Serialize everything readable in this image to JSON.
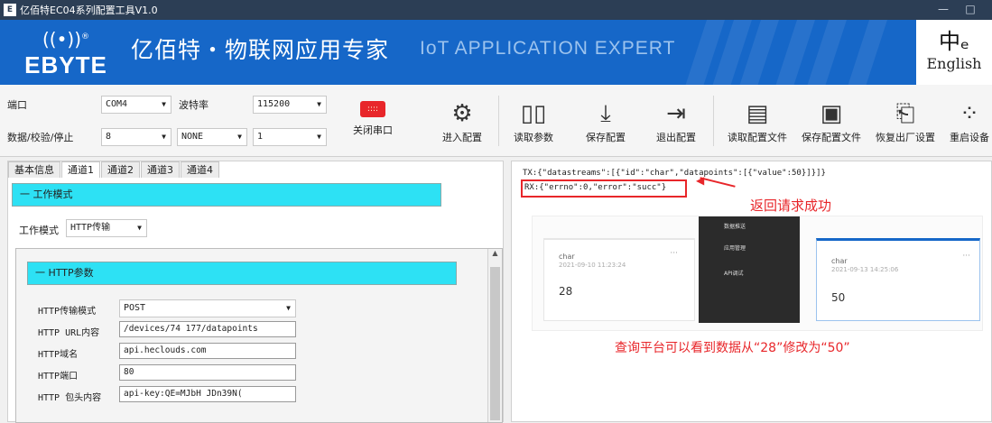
{
  "window": {
    "title": "亿佰特EC04系列配置工具V1.0",
    "app_icon": "E"
  },
  "banner": {
    "logo_brand": "EBYTE",
    "slogan_cn": "亿佰特・物联网应用专家",
    "slogan_en": "IoT APPLICATION EXPERT",
    "language": "English"
  },
  "serial": {
    "port_label": "端口",
    "port_value": "COM4",
    "baud_label": "波特率",
    "baud_value": "115200",
    "frame_label": "数据/校验/停止",
    "data_bits": "8",
    "parity": "NONE",
    "stop_bits": "1",
    "close_label": "关闭串口"
  },
  "toolbar": {
    "enter_config": "进入配置",
    "read_params": "读取参数",
    "save_config": "保存配置",
    "exit_config": "退出配置",
    "read_config_file": "读取配置文件",
    "save_config_file": "保存配置文件",
    "restore_factory": "恢复出厂设置",
    "restart_device": "重启设备"
  },
  "tabs": [
    "基本信息",
    "通道1",
    "通道2",
    "通道3",
    "通道4"
  ],
  "work_mode": {
    "header": "一 工作模式",
    "label": "工作模式",
    "value": "HTTP传输"
  },
  "http": {
    "header": "一 HTTP参数",
    "mode_label": "HTTP传输模式",
    "mode_value": "POST",
    "url_label": "HTTP URL内容",
    "url_value": "/devices/74      177/datapoints",
    "domain_label": "HTTP域名",
    "domain_value": "api.heclouds.com",
    "port_label": "HTTP端口",
    "port_value": "80",
    "header_label": "HTTP 包头内容",
    "header_value": "api-key:QE=MJbH              JDn39N("
  },
  "log": {
    "tx": "TX:{\"datastreams\":[{\"id\":\"char\",\"datapoints\":[{\"value\":50}]}]}",
    "rx": "RX:{\"errno\":0,\"error\":\"succ\"}"
  },
  "annotations": {
    "success": "返回请求成功",
    "note": "查询平台可以看到数据从“28”修改为“50”"
  },
  "platform": {
    "card1": {
      "name": "char",
      "time": "2021-09-10 11:23:24",
      "value": "28",
      "more": "···"
    },
    "card2": {
      "name": "char",
      "time": "2021-09-13 14:25:06",
      "value": "50",
      "more": "···"
    },
    "menu": [
      "数据推送",
      "应用管理",
      "API调试"
    ]
  },
  "colors": {
    "banner": "#1667c8",
    "bar": "#2de1f4",
    "annotation": "#e8262a"
  }
}
